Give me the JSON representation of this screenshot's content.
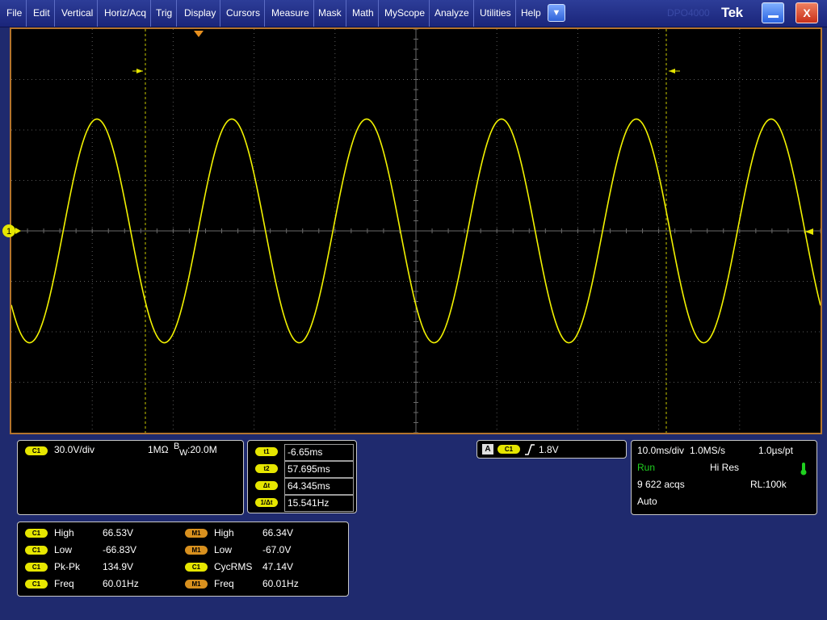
{
  "menu": {
    "items": [
      "File",
      "Edit",
      "Vertical",
      "Horiz/Acq",
      "Trig",
      "Display",
      "Cursors",
      "Measure",
      "Mask",
      "Math",
      "MyScope",
      "Analyze",
      "Utilities",
      "Help"
    ],
    "brand": "Tek",
    "brand_ghost": "DPO4000"
  },
  "colors": {
    "trace": "#f2f200",
    "frame": "#b3742d",
    "math": "#d8901e",
    "run": "#1fd01f"
  },
  "waveform": {
    "channel_marker": "1",
    "cursor_t1_label": "-6.65ms",
    "cursor_t2_label": "57.695ms"
  },
  "channel": {
    "badge": "C1",
    "scale": "30.0V/div",
    "impedance": "1MΩ",
    "bw_b": "B",
    "bw_w": "W",
    "bandwidth": ":20.0M"
  },
  "cursors": [
    {
      "label": "t1",
      "value": "-6.65ms"
    },
    {
      "label": "t2",
      "value": "57.695ms"
    },
    {
      "label": "Δt",
      "value": "64.345ms"
    },
    {
      "label": "1/Δt",
      "value": "15.541Hz"
    }
  ],
  "trigger": {
    "source_a": "A",
    "channel": "C1",
    "slope_icon": "rising-edge",
    "level": "1.8V"
  },
  "acquisition": {
    "timebase": "10.0ms/div",
    "sample_rate": "1.0MS/s",
    "resolution": "1.0µs/pt",
    "state": "Run",
    "mode": "Hi Res",
    "acqs": "9 622 acqs",
    "record_length": "RL:100k",
    "trigger_mode": "Auto"
  },
  "measurements": [
    {
      "badge": "C1",
      "name": "High",
      "value": "66.53V",
      "badge2": "M1",
      "name2": "High",
      "value2": "66.34V",
      "type2": "o"
    },
    {
      "badge": "C1",
      "name": "Low",
      "value": "-66.83V",
      "badge2": "M1",
      "name2": "Low",
      "value2": "-67.0V",
      "type2": "o"
    },
    {
      "badge": "C1",
      "name": "Pk-Pk",
      "value": "134.9V",
      "badge2": "C1",
      "name2": "CycRMS",
      "value2": "47.14V",
      "type2": "y"
    },
    {
      "badge": "C1",
      "name": "Freq",
      "value": "60.01Hz",
      "badge2": "M1",
      "name2": "Freq",
      "value2": "60.01Hz",
      "type2": "o"
    }
  ]
}
